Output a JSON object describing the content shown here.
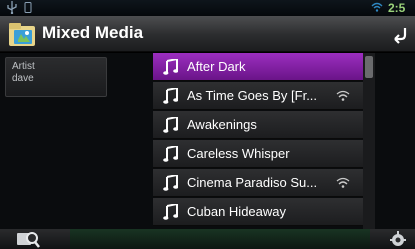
{
  "status": {
    "clock": "2:5",
    "usb_icon": "usb-icon",
    "phone_icon": "phone-icon",
    "wifi_icon": "wifi-icon"
  },
  "header": {
    "title": "Mixed Media",
    "icon": "media-folder-icon",
    "back_icon": "back-arrow-icon"
  },
  "filter": {
    "label": "Artist",
    "value": "dave"
  },
  "list": {
    "items": [
      {
        "label": "After Dark",
        "selected": true,
        "badge": false
      },
      {
        "label": "As Time Goes By [Fr...",
        "selected": false,
        "badge": true
      },
      {
        "label": "Awakenings",
        "selected": false,
        "badge": false
      },
      {
        "label": "Careless Whisper",
        "selected": false,
        "badge": false
      },
      {
        "label": "Cinema Paradiso Su...",
        "selected": false,
        "badge": true
      },
      {
        "label": "Cuban Hideaway",
        "selected": false,
        "badge": false
      }
    ],
    "item_icon": "music-note-icon",
    "badge_icon": "streaming-icon"
  },
  "footer": {
    "search_icon": "search-icon",
    "settings_icon": "settings-icon"
  },
  "colors": {
    "selected": "#8a24ad",
    "accent_green": "#9ad27a"
  }
}
